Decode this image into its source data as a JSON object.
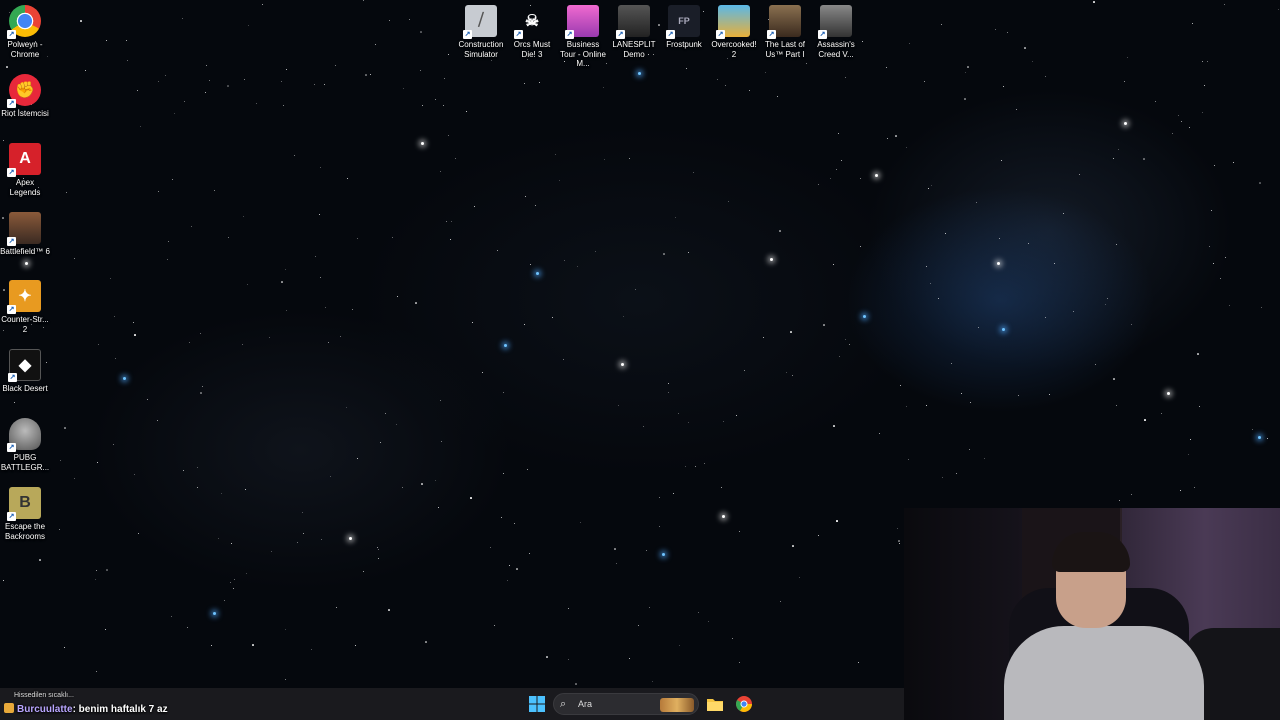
{
  "desktop": {
    "left_icons": [
      {
        "label": "Polweyn - Chrome",
        "icon": "chrome-icon",
        "color": "#ffffff"
      },
      {
        "label": "Riot İstemcisi",
        "icon": "riot-client-icon",
        "color": "#e8283a"
      },
      {
        "label": "Apex Legends",
        "icon": "apex-legends-icon",
        "color": "#d6212a"
      },
      {
        "label": "Battlefield™ 6",
        "icon": "battlefield-icon",
        "color": "#5a3a2a"
      },
      {
        "label": "Counter-Str... 2",
        "icon": "counter-strike-icon",
        "color": "#e89a20"
      },
      {
        "label": "Black Desert",
        "icon": "black-desert-icon",
        "color": "#1a1a1a"
      },
      {
        "label": "PUBG BATTLEGR...",
        "icon": "pubg-icon",
        "color": "#6a6a6a"
      },
      {
        "label": "Escape the Backrooms",
        "icon": "escape-backrooms-icon",
        "color": "#8a7a3a"
      }
    ],
    "top_icons": [
      {
        "label": "Construction Simulator",
        "icon": "construction-simulator-icon",
        "color": "#c7cbd1"
      },
      {
        "label": "Orcs Must Die! 3",
        "icon": "orcs-must-die-icon",
        "color": "#2a2a2a"
      },
      {
        "label": "Business Tour - Online M...",
        "icon": "business-tour-icon",
        "color": "#d84fb8"
      },
      {
        "label": "LANESPLIT Demo",
        "icon": "lanesplit-icon",
        "color": "#3a3a3a"
      },
      {
        "label": "Frostpunk",
        "icon": "frostpunk-icon",
        "color": "#2a2e38"
      },
      {
        "label": "Overcooked! 2",
        "icon": "overcooked-icon",
        "color": "#3aa0d8"
      },
      {
        "label": "The Last of Us™ Part I",
        "icon": "last-of-us-icon",
        "color": "#6a5040"
      },
      {
        "label": "Assassin's Creed V...",
        "icon": "assassins-creed-icon",
        "color": "#5a5a5a"
      }
    ]
  },
  "taskbar": {
    "search_placeholder": "Ara",
    "apps": [
      "windows-start-icon",
      "search-icon",
      "file-explorer-icon",
      "chrome-icon"
    ]
  },
  "stream_overlay": {
    "weather_text": "Hissedilen sıcaklı...",
    "chat_user": "Burcuulatte",
    "chat_message": ": benim haftalık 7 az"
  }
}
